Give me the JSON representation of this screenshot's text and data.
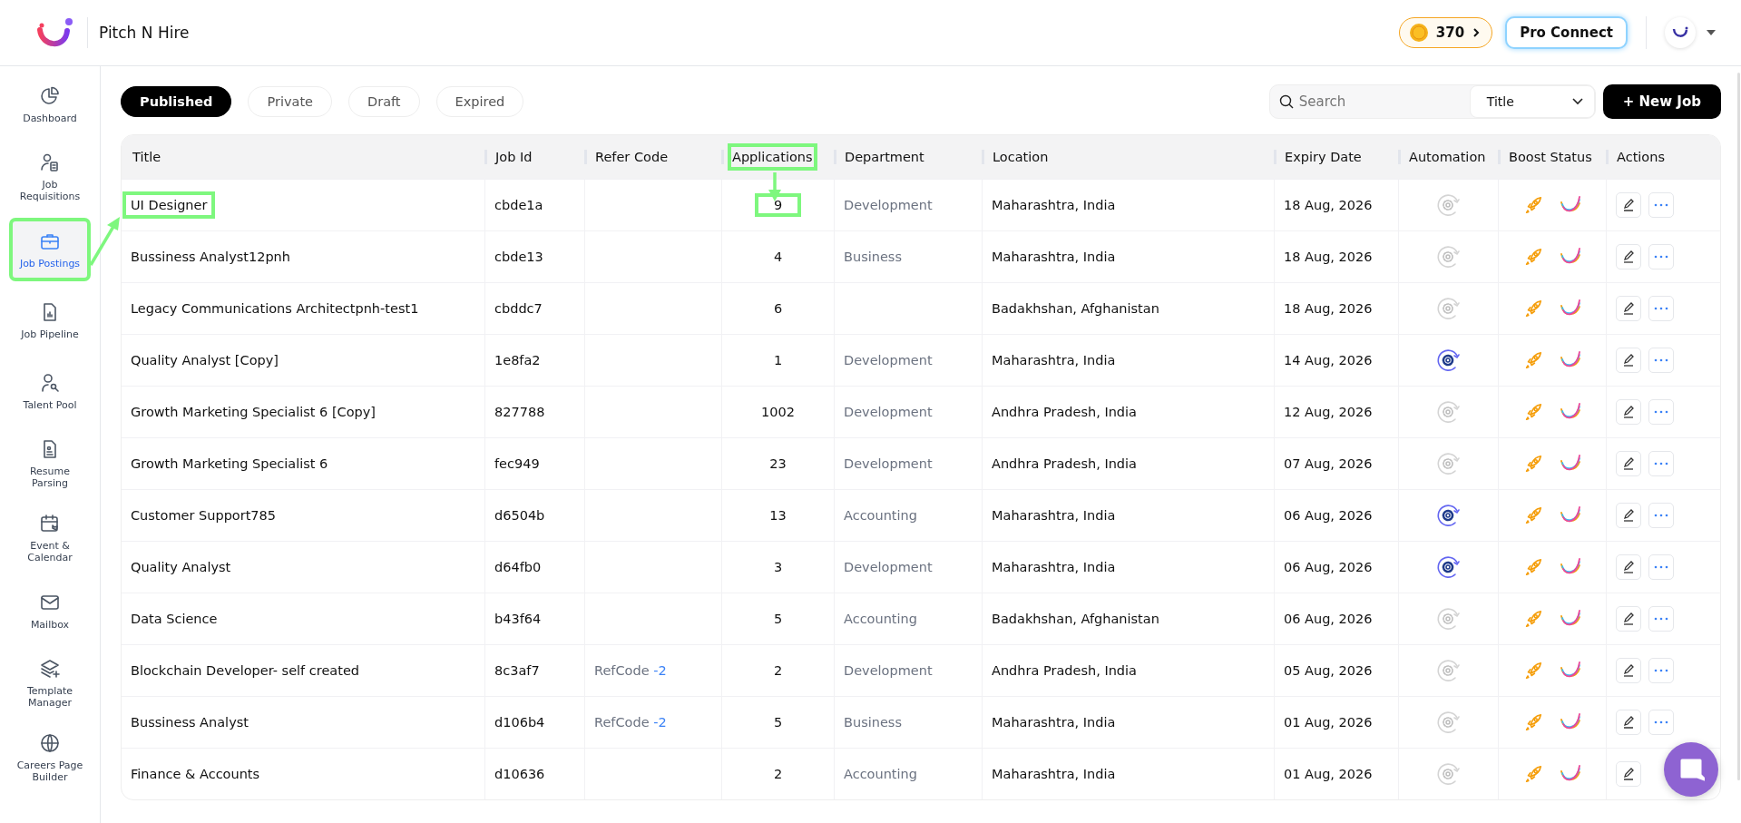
{
  "header": {
    "brand": "Pitch N Hire",
    "coins": "370",
    "pro_button": "Pro Connect"
  },
  "sidebar": {
    "items": [
      {
        "label": "Dashboard",
        "selected": false,
        "highlighted": false
      },
      {
        "label": "Job Requisitions",
        "selected": false,
        "highlighted": false
      },
      {
        "label": "Job Postings",
        "selected": true,
        "highlighted": true
      },
      {
        "label": "Job Pipeline",
        "selected": false,
        "highlighted": false
      },
      {
        "label": "Talent Pool",
        "selected": false,
        "highlighted": false
      },
      {
        "label": "Resume Parsing",
        "selected": false,
        "highlighted": false
      },
      {
        "label": "Event & Calendar",
        "selected": false,
        "highlighted": false
      },
      {
        "label": "Mailbox",
        "selected": false,
        "highlighted": false
      },
      {
        "label": "Template Manager",
        "selected": false,
        "highlighted": false
      },
      {
        "label": "Careers Page Builder",
        "selected": false,
        "highlighted": false
      }
    ]
  },
  "tabs": [
    {
      "label": "Published",
      "selected": true
    },
    {
      "label": "Private",
      "selected": false
    },
    {
      "label": "Draft",
      "selected": false
    },
    {
      "label": "Expired",
      "selected": false
    }
  ],
  "search": {
    "placeholder": "Search",
    "filter": "Title"
  },
  "new_job_button": "+ New Job",
  "table": {
    "columns": [
      {
        "label": "Title",
        "highlighted": false
      },
      {
        "label": "Job Id",
        "highlighted": false
      },
      {
        "label": "Refer Code",
        "highlighted": false
      },
      {
        "label": "Applications",
        "highlighted": true
      },
      {
        "label": "Department",
        "highlighted": false
      },
      {
        "label": "Location",
        "highlighted": false
      },
      {
        "label": "Expiry Date",
        "highlighted": false
      },
      {
        "label": "Automation",
        "highlighted": false
      },
      {
        "label": "Boost Status",
        "highlighted": false
      },
      {
        "label": "Actions",
        "highlighted": false
      }
    ],
    "rows": [
      {
        "title": "UI Designer",
        "job_id": "cbde1a",
        "applications": "9",
        "department": "Development",
        "location": "Maharashtra, India",
        "expiry": "18 Aug, 2026",
        "automation_on": false,
        "title_highlighted": true,
        "applications_highlighted": true
      },
      {
        "title": "Bussiness Analyst12pnh",
        "job_id": "cbde13",
        "applications": "4",
        "department": "Business",
        "location": "Maharashtra, India",
        "expiry": "18 Aug, 2026",
        "automation_on": false,
        "title_highlighted": false,
        "applications_highlighted": false
      },
      {
        "title": "Legacy Communications Architectpnh-test1",
        "job_id": "cbddc7",
        "applications": "6",
        "location": "Badakhshan, Afghanistan",
        "expiry": "18 Aug, 2026",
        "automation_on": false,
        "title_highlighted": false,
        "applications_highlighted": false
      },
      {
        "title": "Quality Analyst [Copy]",
        "job_id": "1e8fa2",
        "applications": "1",
        "department": "Development",
        "location": "Maharashtra, India",
        "expiry": "14 Aug, 2026",
        "automation_on": true,
        "title_highlighted": false,
        "applications_highlighted": false
      },
      {
        "title": "Growth Marketing Specialist 6 [Copy]",
        "job_id": "827788",
        "applications": "1002",
        "department": "Development",
        "location": "Andhra Pradesh, India",
        "expiry": "12 Aug, 2026",
        "automation_on": false,
        "title_highlighted": false,
        "applications_highlighted": false
      },
      {
        "title": "Growth Marketing Specialist 6",
        "job_id": "fec949",
        "applications": "23",
        "department": "Development",
        "location": "Andhra Pradesh, India",
        "expiry": "07 Aug, 2026",
        "automation_on": false,
        "title_highlighted": false,
        "applications_highlighted": false
      },
      {
        "title": "Customer Support785",
        "job_id": "d6504b",
        "applications": "13",
        "department": "Accounting",
        "location": "Maharashtra, India",
        "expiry": "06 Aug, 2026",
        "automation_on": true,
        "title_highlighted": false,
        "applications_highlighted": false
      },
      {
        "title": "Quality Analyst",
        "job_id": "d64fb0",
        "applications": "3",
        "department": "Development",
        "location": "Maharashtra, India",
        "expiry": "06 Aug, 2026",
        "automation_on": true,
        "title_highlighted": false,
        "applications_highlighted": false
      },
      {
        "title": "Data Science",
        "job_id": "b43f64",
        "applications": "5",
        "department": "Accounting",
        "location": "Badakhshan, Afghanistan",
        "expiry": "06 Aug, 2026",
        "automation_on": false,
        "title_highlighted": false,
        "applications_highlighted": false
      },
      {
        "title": "Blockchain Developer- self created",
        "job_id": "8c3af7",
        "refer_code": "RefCode",
        "refer_count": "-2",
        "applications": "2",
        "department": "Development",
        "location": "Andhra Pradesh, India",
        "expiry": "05 Aug, 2026",
        "automation_on": false,
        "title_highlighted": false,
        "applications_highlighted": false
      },
      {
        "title": "Bussiness Analyst",
        "job_id": "d106b4",
        "refer_code": "RefCode",
        "refer_count": "-2",
        "applications": "5",
        "department": "Business",
        "location": "Maharashtra, India",
        "expiry": "01 Aug, 2026",
        "automation_on": false,
        "title_highlighted": false,
        "applications_highlighted": false
      },
      {
        "title": "Finance & Accounts",
        "job_id": "d10636",
        "applications": "2",
        "department": "Accounting",
        "location": "Maharashtra, India",
        "expiry": "01 Aug, 2026",
        "automation_on": false,
        "title_highlighted": false,
        "applications_highlighted": false
      }
    ]
  }
}
